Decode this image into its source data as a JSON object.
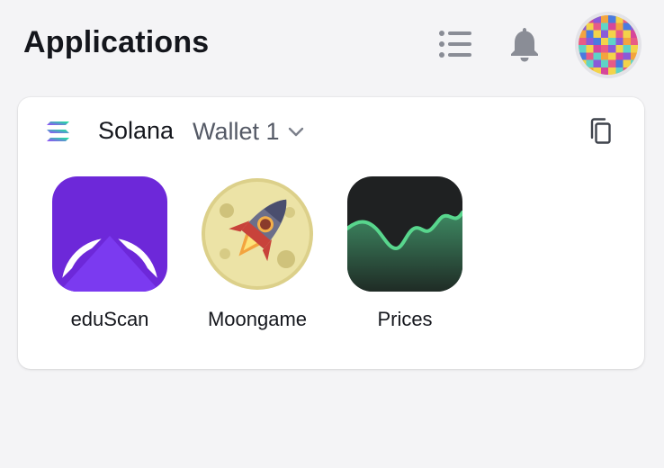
{
  "header": {
    "title": "Applications",
    "list_icon": "list-icon",
    "bell_icon": "bell-icon",
    "avatar_icon": "pixel-avatar"
  },
  "wallet_card": {
    "network_icon": "solana-logo",
    "network": "Solana",
    "wallet_name": "Wallet 1",
    "copy_icon": "copy-icon",
    "apps": [
      {
        "name": "eduScan",
        "icon": "eduscan-icon",
        "color": "#6d28d9"
      },
      {
        "name": "Moongame",
        "icon": "moongame-rocket-icon",
        "color": "#e9de9a"
      },
      {
        "name": "Prices",
        "icon": "prices-chart-icon",
        "color": "#1f2122"
      }
    ]
  },
  "colors": {
    "background": "#f4f4f6",
    "card": "#ffffff",
    "icon_gray": "#8a8d96"
  }
}
